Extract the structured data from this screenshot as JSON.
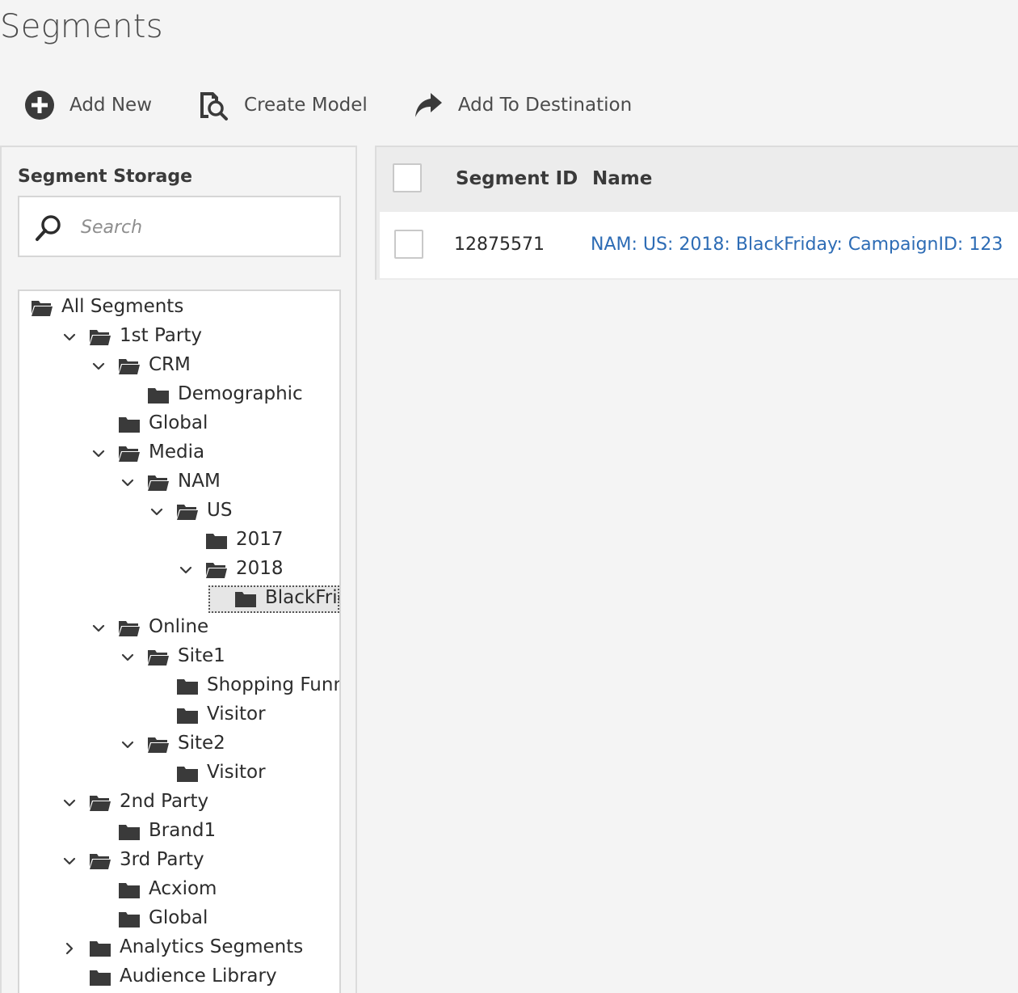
{
  "page": {
    "title": "Segments"
  },
  "toolbar": {
    "add_new": "Add New",
    "create_model": "Create Model",
    "add_to_destination": "Add To Destination"
  },
  "left_panel": {
    "title": "Segment Storage",
    "search_placeholder": "Search"
  },
  "tree": [
    {
      "label": "All Segments",
      "level": 0,
      "chevron": "none",
      "open": true
    },
    {
      "label": "1st Party",
      "level": 1,
      "chevron": "down",
      "open": true
    },
    {
      "label": "CRM",
      "level": 2,
      "chevron": "down",
      "open": true
    },
    {
      "label": "Demographic",
      "level": 3,
      "chevron": "none",
      "open": false
    },
    {
      "label": "Global",
      "level": 2,
      "chevron": "none",
      "open": false
    },
    {
      "label": "Media",
      "level": 2,
      "chevron": "down",
      "open": true
    },
    {
      "label": "NAM",
      "level": 3,
      "chevron": "down",
      "open": true
    },
    {
      "label": "US",
      "level": 4,
      "chevron": "down",
      "open": true
    },
    {
      "label": "2017",
      "level": 5,
      "chevron": "none",
      "open": false
    },
    {
      "label": "2018",
      "level": 5,
      "chevron": "down",
      "open": true
    },
    {
      "label": "BlackFriday",
      "level": 6,
      "chevron": "none",
      "open": false,
      "selected": true
    },
    {
      "label": "Online",
      "level": 2,
      "chevron": "down",
      "open": true
    },
    {
      "label": "Site1",
      "level": 3,
      "chevron": "down",
      "open": true
    },
    {
      "label": "Shopping Funnel",
      "level": 4,
      "chevron": "none",
      "open": false
    },
    {
      "label": "Visitor",
      "level": 4,
      "chevron": "none",
      "open": false
    },
    {
      "label": "Site2",
      "level": 3,
      "chevron": "down",
      "open": true
    },
    {
      "label": "Visitor",
      "level": 4,
      "chevron": "none",
      "open": false
    },
    {
      "label": "2nd Party",
      "level": 1,
      "chevron": "down",
      "open": true
    },
    {
      "label": "Brand1",
      "level": 2,
      "chevron": "none",
      "open": false
    },
    {
      "label": "3rd Party",
      "level": 1,
      "chevron": "down",
      "open": true
    },
    {
      "label": "Acxiom",
      "level": 2,
      "chevron": "none",
      "open": false
    },
    {
      "label": "Global",
      "level": 2,
      "chevron": "none",
      "open": false
    },
    {
      "label": "Analytics Segments",
      "level": 1,
      "chevron": "right",
      "open": false
    },
    {
      "label": "Audience Library",
      "level": 1,
      "chevron": "none",
      "open": false
    }
  ],
  "table": {
    "headers": {
      "segment_id": "Segment ID",
      "name": "Name"
    },
    "rows": [
      {
        "segment_id": "12875571",
        "name": "NAM: US: 2018: BlackFriday: CampaignID: 123"
      }
    ]
  },
  "colors": {
    "link": "#2d6cb5",
    "icon": "#3a3a3a"
  }
}
